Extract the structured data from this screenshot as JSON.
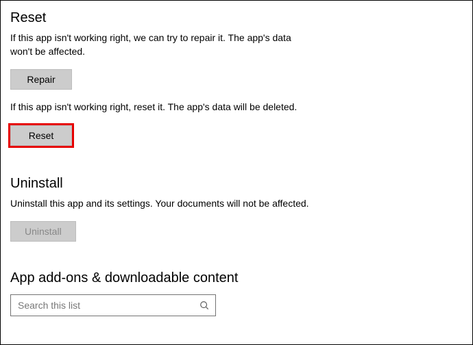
{
  "reset": {
    "title": "Reset",
    "repair_description": "If this app isn't working right, we can try to repair it. The app's data won't be affected.",
    "repair_label": "Repair",
    "reset_description": "If this app isn't working right, reset it. The app's data will be deleted.",
    "reset_label": "Reset"
  },
  "uninstall": {
    "title": "Uninstall",
    "description": "Uninstall this app and its settings. Your documents will not be affected.",
    "button_label": "Uninstall"
  },
  "addons": {
    "title": "App add-ons & downloadable content",
    "search_placeholder": "Search this list"
  }
}
